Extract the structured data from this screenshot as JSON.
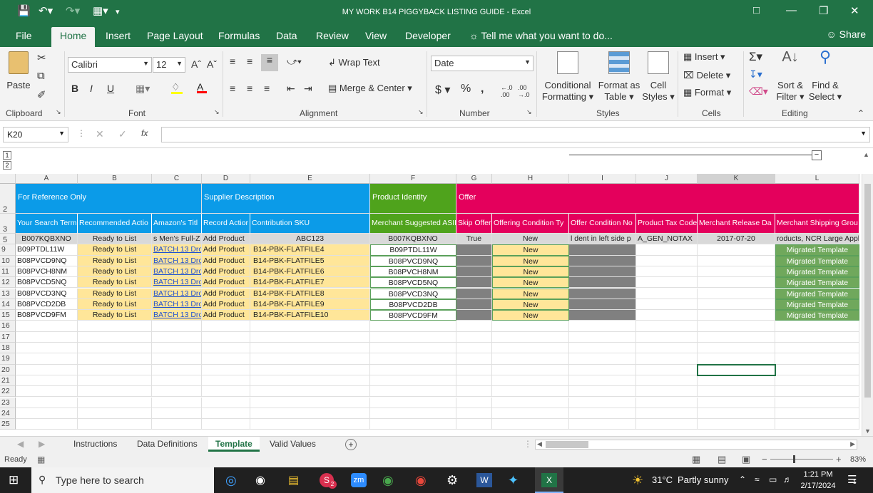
{
  "window": {
    "title": "MY WORK B14 PIGGYBACK LISTING GUIDE - Excel"
  },
  "tabs": [
    "File",
    "Home",
    "Insert",
    "Page Layout",
    "Formulas",
    "Data",
    "Review",
    "View",
    "Developer"
  ],
  "tell_me": "Tell me what you want to do...",
  "share": "Share",
  "ribbon": {
    "paste": "Paste",
    "font_name": "Calibri",
    "font_size": "12",
    "bold": "B",
    "italic": "I",
    "underline": "U",
    "wrap_text": "Wrap Text",
    "merge_center": "Merge & Center",
    "number_format": "Date",
    "currency": "$",
    "percent": "%",
    "comma": ",",
    "cond_fmt_1": "Conditional",
    "cond_fmt_2": "Formatting",
    "fmt_table_1": "Format as",
    "fmt_table_2": "Table",
    "cell_styles_1": "Cell",
    "cell_styles_2": "Styles",
    "insert": "Insert",
    "delete": "Delete",
    "format": "Format",
    "sort_1": "Sort &",
    "sort_2": "Filter",
    "find_1": "Find &",
    "find_2": "Select",
    "groups": [
      "Clipboard",
      "Font",
      "Alignment",
      "Number",
      "Styles",
      "Cells",
      "Editing"
    ]
  },
  "formula_bar": {
    "name_box": "K20",
    "fx": "fx",
    "value": ""
  },
  "outline_levels": [
    "1",
    "2"
  ],
  "columns": [
    "A",
    "B",
    "C",
    "D",
    "E",
    "F",
    "G",
    "H",
    "I",
    "J",
    "K",
    "L"
  ],
  "header_row2": {
    "a": "For Reference Only",
    "d": "Supplier Description",
    "f": "Product Identity",
    "g": "Offer"
  },
  "header_row3": [
    "Your Search Term",
    "Recommended Actio",
    "Amazon's Titl",
    "Record Actior",
    "Contribution SKU",
    "Merchant Suggested ASII",
    "Skip Offer",
    "Offering Condition Ty",
    "Offer Condition No",
    "Product Tax Code",
    "Merchant Release Da",
    "Merchant Shipping Grou"
  ],
  "row5": [
    "B007KQBXNO",
    "Ready to List",
    "s Men's Full-Z",
    "Add Product",
    "ABC123",
    "B007KQBXNO",
    "True",
    "New",
    "l dent in left side p",
    "A_GEN_NOTAX",
    "2017-07-20",
    "roducts, NCR Large Appl"
  ],
  "rows": [
    {
      "n": "9",
      "a": "B09PTDL11W",
      "b": "Ready to List",
      "c": "BATCH 13 Dro",
      "d": "Add Product",
      "e": "B14-PBK-FLATFILE4",
      "f": "B09PTDL11W",
      "h": "New",
      "l": "Migrated Template"
    },
    {
      "n": "10",
      "a": "B08PVCD9NQ",
      "b": "Ready to List",
      "c": "BATCH 13 Dro",
      "d": "Add Product",
      "e": "B14-PBK-FLATFILE5",
      "f": "B08PVCD9NQ",
      "h": "New",
      "l": "Migrated Template"
    },
    {
      "n": "11",
      "a": "B08PVCH8NM",
      "b": "Ready to List",
      "c": "BATCH 13 Dro",
      "d": "Add Product",
      "e": "B14-PBK-FLATFILE6",
      "f": "B08PVCH8NM",
      "h": "New",
      "l": "Migrated Template"
    },
    {
      "n": "12",
      "a": "B08PVCD5NQ",
      "b": "Ready to List",
      "c": "BATCH 13 Dro",
      "d": "Add Product",
      "e": "B14-PBK-FLATFILE7",
      "f": "B08PVCD5NQ",
      "h": "New",
      "l": "Migrated Template"
    },
    {
      "n": "13",
      "a": "B08PVCD3NQ",
      "b": "Ready to List",
      "c": "BATCH 13 Dro",
      "d": "Add Product",
      "e": "B14-PBK-FLATFILE8",
      "f": "B08PVCD3NQ",
      "h": "New",
      "l": "Migrated Template"
    },
    {
      "n": "14",
      "a": "B08PVCD2DB",
      "b": "Ready to List",
      "c": "BATCH 13 Dro",
      "d": "Add Product",
      "e": "B14-PBK-FLATFILE9",
      "f": "B08PVCD2DB",
      "h": "New",
      "l": "Migrated Template"
    },
    {
      "n": "15",
      "a": "B08PVCD9FM",
      "b": "Ready to List",
      "c": "BATCH 13 Dro",
      "d": "Add Product",
      "e": "B14-PBK-FLATFILE10",
      "f": "B08PVCD9FM",
      "h": "New",
      "l": "Migrated Template"
    }
  ],
  "empty_rows": [
    "16",
    "17",
    "18",
    "19",
    "20",
    "21",
    "22",
    "23",
    "24",
    "25"
  ],
  "header_rows": [
    "2",
    "3",
    "5"
  ],
  "sheets": [
    "Instructions",
    "Data Definitions",
    "Template",
    "Valid Values"
  ],
  "active_sheet": "Template",
  "status": {
    "ready": "Ready",
    "zoom": "83%"
  },
  "taskbar": {
    "search": "Type here to search",
    "weather_temp": "31°C",
    "weather_desc": "Partly sunny",
    "time": "1:21 PM",
    "date": "2/17/2024",
    "zoom_app": "zm",
    "word_app": "W",
    "excel_app": "X",
    "notif_badge": "2",
    "action_badge": "1"
  },
  "colors": {
    "excel_green": "#217346",
    "blue": "#0b9be8",
    "green": "#4fa31c",
    "magenta": "#e4005c",
    "yellow": "#ffe699",
    "gray": "#808080",
    "light_green": "#70a85c"
  }
}
